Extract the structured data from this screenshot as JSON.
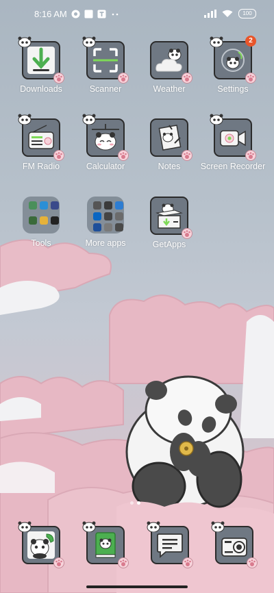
{
  "status_bar": {
    "time": "8:16 AM",
    "battery": "100",
    "left_icons": [
      "app-notification-icon",
      "square-notification-icon",
      "t-notification-icon",
      "more-notifications-icon"
    ],
    "right_icons": [
      "signal-icon",
      "wifi-icon",
      "battery-icon"
    ]
  },
  "apps": [
    {
      "label": "Downloads",
      "icon": "download-arrow-icon"
    },
    {
      "label": "Scanner",
      "icon": "scanner-icon"
    },
    {
      "label": "Weather",
      "icon": "weather-cloud-icon"
    },
    {
      "label": "Settings",
      "icon": "settings-icon",
      "badge": "2"
    },
    {
      "label": "FM Radio",
      "icon": "radio-icon"
    },
    {
      "label": "Calculator",
      "icon": "calculator-icon"
    },
    {
      "label": "Notes",
      "icon": "notes-icon"
    },
    {
      "label": "Screen Recorder",
      "icon": "screen-recorder-icon"
    },
    {
      "label": "Tools",
      "icon": "folder-icon"
    },
    {
      "label": "More apps",
      "icon": "folder-icon"
    },
    {
      "label": "GetApps",
      "icon": "getapps-box-icon"
    }
  ],
  "dock": [
    {
      "icon": "phone-icon"
    },
    {
      "icon": "contacts-book-icon"
    },
    {
      "icon": "messages-icon"
    },
    {
      "icon": "camera-icon"
    }
  ],
  "page_indicator": {
    "count": 2,
    "active": 2
  },
  "colors": {
    "icon_bg": "#6f7883",
    "icon_border": "#2b2b2b",
    "cloud_pink": "#e7b8c4",
    "badge": "#e8552a",
    "download_green": "#4caf50"
  }
}
